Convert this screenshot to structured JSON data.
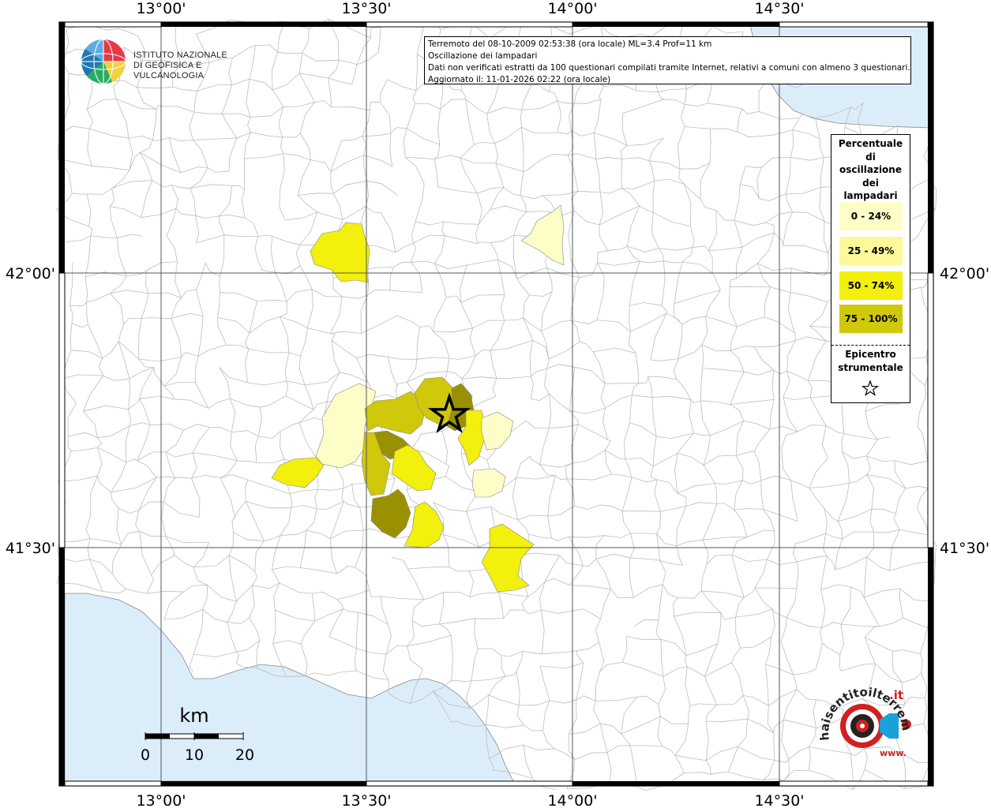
{
  "info": {
    "line1": "Terremoto del 08-10-2009 02:53:38 (ora locale) ML=3.4 Prof=11 km",
    "line2": "Oscillazione dei lampadari",
    "line3": "Dati non verificati estratti da 100 questionari compilati tramite Internet, relativi a comuni con almeno 3 questionari.",
    "line4": "Aggiornato il: 11-01-2026 02:22 (ora locale)"
  },
  "axes": {
    "top_labels": [
      "13°00'",
      "13°30'",
      "14°00'",
      "14°30'"
    ],
    "bottom_labels": [
      "13°00'",
      "13°30'",
      "14°00'",
      "14°30'"
    ],
    "left_labels": [
      "42°00'",
      "41°30'"
    ],
    "right_labels": [
      "42°00'",
      "41°30'"
    ]
  },
  "legend": {
    "title": [
      "Percentuale",
      "di",
      "oscillazione",
      "dei",
      "lampadari"
    ],
    "items": [
      {
        "label": "0 - 24%",
        "color": "#fdfdc8"
      },
      {
        "label": "25 - 49%",
        "color": "#fbf99a"
      },
      {
        "label": "50 - 74%",
        "color": "#f2f00c"
      },
      {
        "label": "75 - 100%",
        "color": "#d0c80a"
      }
    ],
    "epicentro": [
      "Epicentro",
      "strumentale"
    ]
  },
  "logo": {
    "line1": "ISTITUTO NAZIONALE",
    "line2": "DI GEOFISICA E VULCANOLOGIA"
  },
  "scale": {
    "unit": "km",
    "ticks": [
      "0",
      "10",
      "20"
    ]
  },
  "badge": {
    "text_main": "haisentitoilterremoto",
    "text_it": ".it",
    "text_www": "www."
  },
  "colors": {
    "sea": "#dcedfa",
    "land": "#ffffff",
    "boundaries": "#bdbdbd",
    "grid": "#555555",
    "class_0_24": "#fdfdc8",
    "class_25_49": "#fbf99a",
    "class_50_74": "#f2f00c",
    "class_75_100": "#d0c80a",
    "class_dark": "#9a9100"
  }
}
